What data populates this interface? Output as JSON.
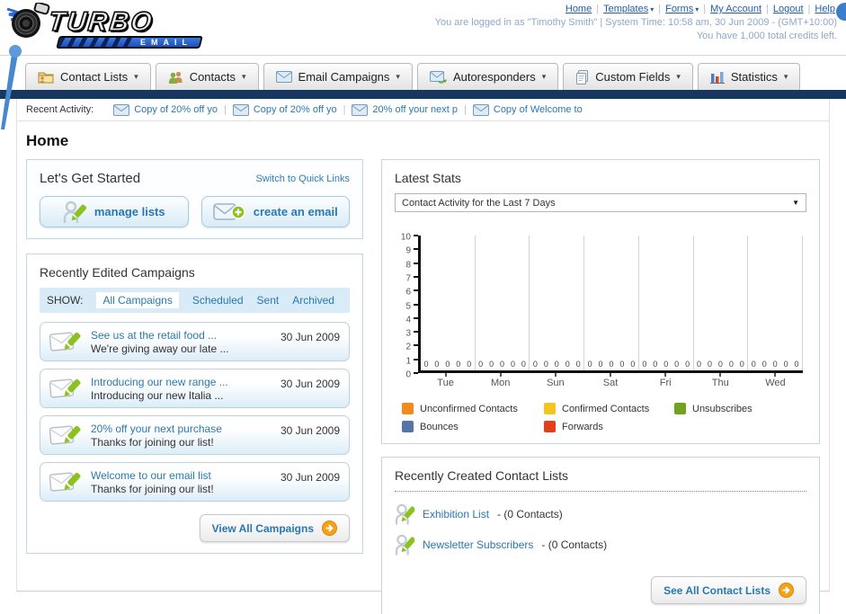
{
  "header": {
    "logo": {
      "line1": "TURBO",
      "line2": "EMAIL"
    },
    "nav": [
      {
        "label": "Home",
        "dropdown": false
      },
      {
        "label": "Templates",
        "dropdown": true
      },
      {
        "label": "Forms",
        "dropdown": true
      },
      {
        "label": "My Account",
        "dropdown": false
      },
      {
        "label": "Logout",
        "dropdown": false
      },
      {
        "label": "Help",
        "dropdown": false
      }
    ],
    "login_info": "You are logged in as \"Timothy Smith\" | System Time: 10:58 am, 30 Jun 2009 - (GMT+10:00)",
    "credits": "You have 1,000 total credits left."
  },
  "tabs": [
    {
      "label": "Contact Lists",
      "icon": "folder-contacts-icon"
    },
    {
      "label": "Contacts",
      "icon": "people-icon"
    },
    {
      "label": "Email Campaigns",
      "icon": "envelope-icon"
    },
    {
      "label": "Autoresponders",
      "icon": "envelope-arrow-icon"
    },
    {
      "label": "Custom Fields",
      "icon": "pages-icon"
    },
    {
      "label": "Statistics",
      "icon": "bar-chart-icon"
    }
  ],
  "recent_activity": {
    "label": "Recent Activity:",
    "items": [
      "Copy of 20% off yo",
      "Copy of 20% off yo",
      "20% off your next p",
      "Copy of Welcome to"
    ]
  },
  "page_title": "Home",
  "get_started": {
    "title": "Let's Get Started",
    "switch_link": "Switch to Quick Links",
    "buttons": [
      {
        "label": "manage lists",
        "icon": "person-pencil-icon"
      },
      {
        "label": "create an email",
        "icon": "envelope-plus-icon"
      }
    ]
  },
  "campaigns": {
    "title": "Recently Edited Campaigns",
    "show_label": "SHOW:",
    "filters": [
      "All Campaigns",
      "Scheduled",
      "Sent",
      "Archived"
    ],
    "active_filter": "All Campaigns",
    "rows": [
      {
        "title": "See us at the retail food ...",
        "subtitle": "We're giving away our late ...",
        "date": "30 Jun 2009"
      },
      {
        "title": "Introducing our new range ...",
        "subtitle": "Introducing our new Italia ...",
        "date": "30 Jun 2009"
      },
      {
        "title": "20% off your next purchase",
        "subtitle": "Thanks for joining our list!",
        "date": "30 Jun 2009"
      },
      {
        "title": "Welcome to our email list",
        "subtitle": "Thanks for joining our list!",
        "date": "30 Jun 2009"
      }
    ],
    "view_all_label": "View All Campaigns"
  },
  "stats": {
    "title": "Latest Stats",
    "period_selected": "Contact Activity for the Last 7 Days"
  },
  "chart_data": {
    "type": "bar",
    "title": "Contact Activity for the Last 7 Days",
    "categories": [
      "Tue",
      "Mon",
      "Sun",
      "Sat",
      "Fri",
      "Thu",
      "Wed"
    ],
    "series": [
      {
        "name": "Unconfirmed Contacts",
        "color": "#f08c1e",
        "values": [
          0,
          0,
          0,
          0,
          0,
          0,
          0
        ]
      },
      {
        "name": "Confirmed Contacts",
        "color": "#f5c41e",
        "values": [
          0,
          0,
          0,
          0,
          0,
          0,
          0
        ]
      },
      {
        "name": "Unsubscribes",
        "color": "#70a41f",
        "values": [
          0,
          0,
          0,
          0,
          0,
          0,
          0
        ]
      },
      {
        "name": "Bounces",
        "color": "#5574a8",
        "values": [
          0,
          0,
          0,
          0,
          0,
          0,
          0
        ]
      },
      {
        "name": "Forwards",
        "color": "#e2401c",
        "values": [
          0,
          0,
          0,
          0,
          0,
          0,
          0
        ]
      }
    ],
    "ylim": [
      0,
      10
    ],
    "ytick_step": 1,
    "xlabel": "",
    "ylabel": "",
    "grid": "vertical-only",
    "legend_position": "bottom",
    "value_labels_shown": true
  },
  "contact_lists": {
    "title": "Recently Created Contact Lists",
    "items": [
      {
        "name": "Exhibition List",
        "detail": "- (0 Contacts)"
      },
      {
        "name": "Newsletter Subscribers",
        "detail": "- (0 Contacts)"
      }
    ],
    "see_all_label": "See All Contact Lists"
  },
  "colors": {
    "navy_bar": "#17375e",
    "link_blue": "#2878b0",
    "nav_link_blue": "#1f5fa9",
    "panel_border": "#c4d6e0",
    "arrow_button_orange": "#f5a21b"
  }
}
